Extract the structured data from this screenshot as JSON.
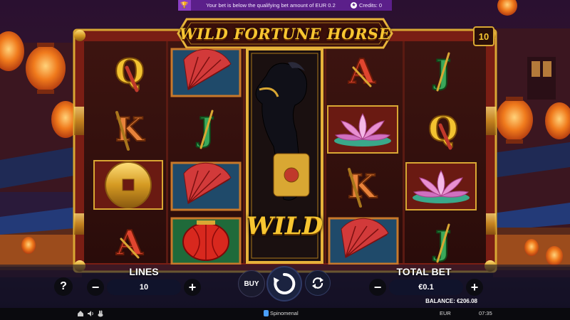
{
  "notification": {
    "message": "Your bet is below the qualifying bet amount of EUR 0.2",
    "credits": "Credits: 0",
    "trophy_icon": "trophy-icon",
    "credits_icon": "star-coin-icon"
  },
  "game": {
    "title": "WILD FORTUNE HORSE",
    "active_lines": "10",
    "wild_label": "WILD"
  },
  "reels": [
    [
      "Q",
      "K",
      "coin",
      "A"
    ],
    [
      "fan",
      "J",
      "fan",
      "lantern"
    ],
    [
      "wild",
      "wild",
      "wild",
      "wild"
    ],
    [
      "A",
      "lotus",
      "K",
      "fan"
    ],
    [
      "J",
      "Q",
      "lotus",
      "J"
    ]
  ],
  "controls": {
    "help": "?",
    "lines_label": "LINES",
    "lines_value": "10",
    "minus": "−",
    "plus": "+",
    "buy": "BUY",
    "total_bet_label": "TOTAL BET",
    "total_bet_value": "€0.1",
    "spin_icon": "spin-icon",
    "autoplay_icon": "autoplay-icon"
  },
  "footer": {
    "balance": "BALANCE: €206.08",
    "brand": "Spinomenal",
    "currency": "EUR",
    "time": "07:35",
    "home_icon": "home-icon",
    "sound_icon": "sound-icon",
    "rabbit_icon": "turbo-rabbit-icon"
  },
  "colors": {
    "gold": "#f7c631",
    "frame_red": "#6b1a12",
    "notification_purple": "#5b1f8a",
    "royal_red": "#c0392b",
    "royal_green": "#1f8a3a"
  }
}
